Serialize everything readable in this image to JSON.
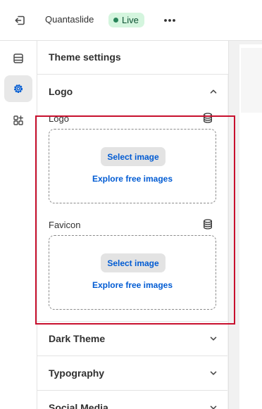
{
  "topbar": {
    "exit_icon": "exit-icon",
    "store_name": "Quantaslide",
    "status_badge": "Live",
    "more_icon": "ellipsis-icon"
  },
  "rail": {
    "items": [
      {
        "name": "sections",
        "icon": "sections-icon",
        "active": false
      },
      {
        "name": "theme-settings",
        "icon": "gear-icon",
        "active": true
      },
      {
        "name": "apps",
        "icon": "apps-icon",
        "active": false
      }
    ]
  },
  "panel": {
    "title": "Theme settings",
    "sections": [
      {
        "title": "Logo",
        "expanded": true
      },
      {
        "title": "Dark Theme",
        "expanded": false
      },
      {
        "title": "Typography",
        "expanded": false
      },
      {
        "title": "Social Media",
        "expanded": false
      }
    ],
    "logo_field": {
      "label": "Logo",
      "select_label": "Select image",
      "explore_label": "Explore free images"
    },
    "favicon_field": {
      "label": "Favicon",
      "select_label": "Select image",
      "explore_label": "Explore free images"
    }
  },
  "colors": {
    "accent_link": "#005bd3",
    "live_badge_bg": "#d4f5de",
    "highlight": "#c8102e"
  }
}
